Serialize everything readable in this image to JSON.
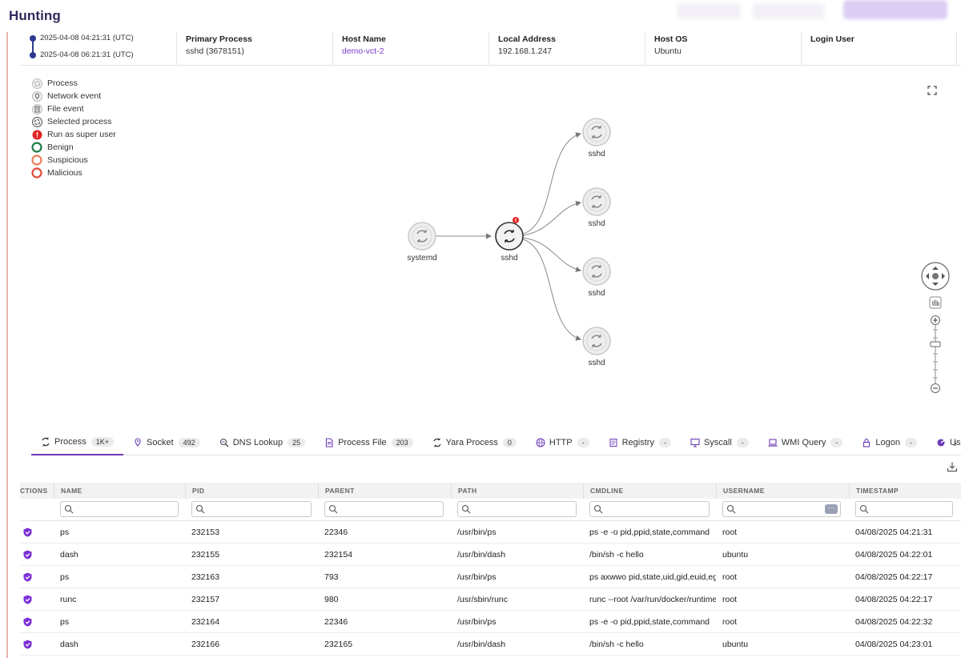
{
  "app": {
    "title": "Hunting"
  },
  "summary": {
    "time_start": "2025-04-08 04:21:31 (UTC)",
    "time_end": "2025-04-08 06:21:31 (UTC)",
    "columns": [
      {
        "label": "Primary Process",
        "value": "sshd (3678151)"
      },
      {
        "label": "Host Name",
        "value": "demo-vct-2"
      },
      {
        "label": "Local Address",
        "value": "192.168.1.247"
      },
      {
        "label": "Host OS",
        "value": "Ubuntu"
      },
      {
        "label": "Login User",
        "value": ""
      }
    ]
  },
  "legend": [
    {
      "label": "Process",
      "icon": "process-icon"
    },
    {
      "label": "Network event",
      "icon": "network-event-icon"
    },
    {
      "label": "File event",
      "icon": "file-event-icon"
    },
    {
      "label": "Selected process",
      "icon": "selected-process-icon"
    },
    {
      "label": "Run as super user",
      "icon": "super-user-icon"
    },
    {
      "label": "Benign",
      "icon": "benign-ring-icon"
    },
    {
      "label": "Suspicious",
      "icon": "suspicious-ring-icon"
    },
    {
      "label": "Malicious",
      "icon": "malicious-ring-icon"
    }
  ],
  "graph": {
    "nodes": [
      {
        "label": "systemd"
      },
      {
        "label": "sshd"
      },
      {
        "label": "sshd"
      },
      {
        "label": "sshd"
      },
      {
        "label": "sshd"
      },
      {
        "label": "sshd"
      }
    ]
  },
  "tabs": [
    {
      "label": "Process",
      "count": "1K+",
      "icon": "process-icon"
    },
    {
      "label": "Socket",
      "count": "492",
      "icon": "socket-icon"
    },
    {
      "label": "DNS Lookup",
      "count": "25",
      "icon": "dns-lookup-icon"
    },
    {
      "label": "Process File",
      "count": "203",
      "icon": "process-file-icon"
    },
    {
      "label": "Yara Process",
      "count": "0",
      "icon": "yara-process-icon"
    },
    {
      "label": "HTTP",
      "count": "-",
      "icon": "http-icon"
    },
    {
      "label": "Registry",
      "count": "-",
      "icon": "registry-icon"
    },
    {
      "label": "Syscall",
      "count": "-",
      "icon": "syscall-icon"
    },
    {
      "label": "WMI Query",
      "count": "-",
      "icon": "wmi-query-icon"
    },
    {
      "label": "Logon",
      "count": "-",
      "icon": "logon-icon"
    },
    {
      "label": "User event",
      "count": "",
      "icon": "user-event-icon"
    }
  ],
  "table": {
    "columns": [
      "CTIONS",
      "NAME",
      "PID",
      "PARENT",
      "PATH",
      "CMDLINE",
      "USERNAME",
      "TIMESTAMP"
    ],
    "rows": [
      [
        "ps",
        "232153",
        "22346",
        "/usr/bin/ps",
        "ps -e -o pid,ppid,state,command",
        "root",
        "04/08/2025 04:21:31"
      ],
      [
        "dash",
        "232155",
        "232154",
        "/usr/bin/dash",
        "/bin/sh -c hello",
        "ubuntu",
        "04/08/2025 04:22:01"
      ],
      [
        "ps",
        "232163",
        "793",
        "/usr/bin/ps",
        "ps axwwo pid,state,uid,gid,euid,egid",
        "root",
        "04/08/2025 04:22:17"
      ],
      [
        "runc",
        "232157",
        "980",
        "/usr/sbin/runc",
        "runc --root /var/run/docker/runtime",
        "root",
        "04/08/2025 04:22:17"
      ],
      [
        "ps",
        "232164",
        "22346",
        "/usr/bin/ps",
        "ps -e -o pid,ppid,state,command",
        "root",
        "04/08/2025 04:22:32"
      ],
      [
        "dash",
        "232166",
        "232165",
        "/usr/bin/dash",
        "/bin/sh -c hello",
        "ubuntu",
        "04/08/2025 04:23:01"
      ]
    ]
  },
  "colors": {
    "accent": "#6b3ab5",
    "link": "#7a3dd0",
    "title": "#2d2a5a",
    "timeline": "#2b3a8c"
  }
}
